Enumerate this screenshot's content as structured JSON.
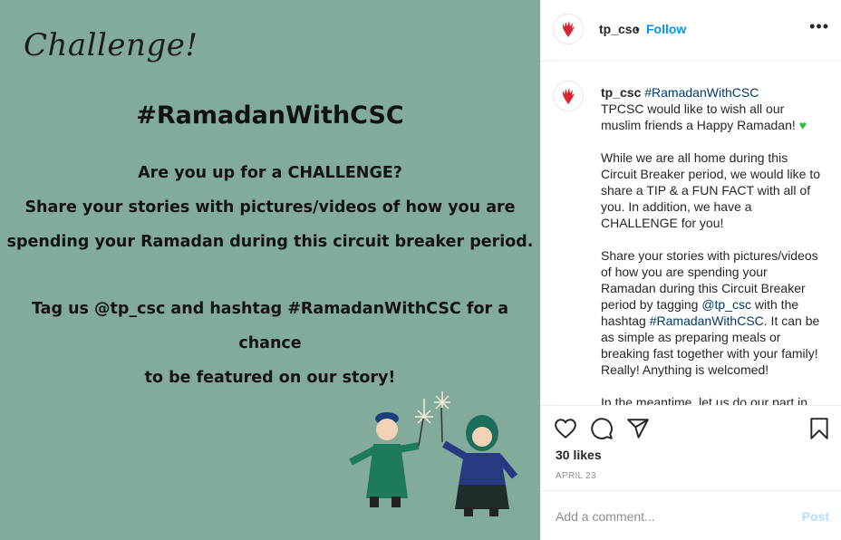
{
  "media": {
    "challenge_word": "Challenge!",
    "hashtag_title": "#RamadanWithCSC",
    "lines_block1": [
      "Are you up for a CHALLENGE?",
      "Share your stories with pictures/videos of how you are",
      "spending your Ramadan during this circuit breaker period."
    ],
    "lines_block2": [
      "Tag us @tp_csc and hashtag #RamadanWithCSC for a chance",
      "to be featured on our story!"
    ]
  },
  "header": {
    "username": "tp_csc",
    "separator": "•",
    "follow_label": "Follow",
    "more_label": "•••"
  },
  "caption": {
    "username": "tp_csc",
    "hashtag": "#RamadanWithCSC",
    "para1": "TPCSC would like to wish all our muslim friends a Happy Ramadan!",
    "para1_emoji": "♥",
    "para2": "While we are all home during this Circuit Breaker period, we would like to share a TIP & a FUN FACT with all of you. In addition, we have a CHALLENGE for you!",
    "para3_a": "Share your stories with pictures/videos of how you are spending your Ramadan during this Circuit Breaker period by tagging",
    "para3_mention": "@tp_csc",
    "para3_b": "with the hashtag",
    "para3_hashtag": "#RamadanWithCSC",
    "para3_c": ". It can be as simple as preparing meals or breaking fast together with your family! Really! Anything is welcomed!",
    "para4": "In the meantime, let us do our part in"
  },
  "actions": {
    "icons": [
      "heart-icon",
      "comment-icon",
      "share-icon",
      "bookmark-icon"
    ],
    "likes": "30 likes",
    "date": "APRIL 23"
  },
  "comment": {
    "placeholder": "Add a comment...",
    "post_label": "Post"
  },
  "colors": {
    "media_bg": "#82ab9b",
    "link_blue": "#0095f6",
    "hashtag_blue": "#00376b",
    "brand_red": "#d9262e"
  }
}
